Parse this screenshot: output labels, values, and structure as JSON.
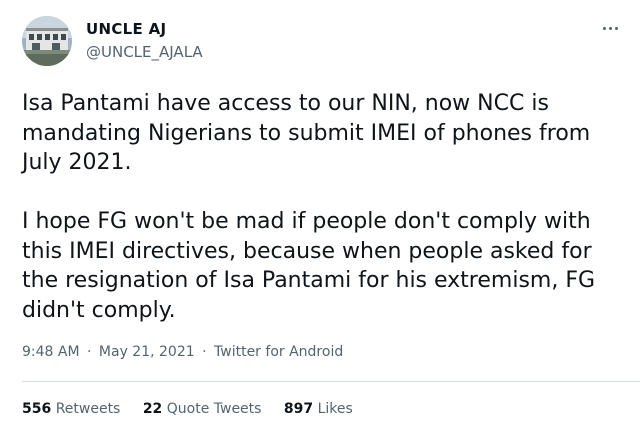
{
  "author": {
    "display_name": "UNCLE AJ",
    "handle": "@UNCLE_AJALA",
    "avatar_icon": "profile-photo-building"
  },
  "tweet": {
    "paragraphs": [
      "Isa Pantami have access to our NIN, now NCC is mandating Nigerians to submit IMEI of phones from July 2021.",
      "I hope FG won't be mad if people don't comply with this IMEI directives, because when people asked for the resignation of Isa Pantami for his extremism, FG didn't comply."
    ]
  },
  "meta": {
    "time": "9:48 AM",
    "separator": "·",
    "date": "May 21, 2021",
    "source": "Twitter for Android"
  },
  "stats": {
    "retweets_count": "556",
    "retweets_label": "Retweets",
    "quotes_count": "22",
    "quotes_label": "Quote Tweets",
    "likes_count": "897",
    "likes_label": "Likes"
  },
  "colors": {
    "text_primary": "#0f1419",
    "text_secondary": "#536471",
    "divider": "#d6dde2"
  }
}
